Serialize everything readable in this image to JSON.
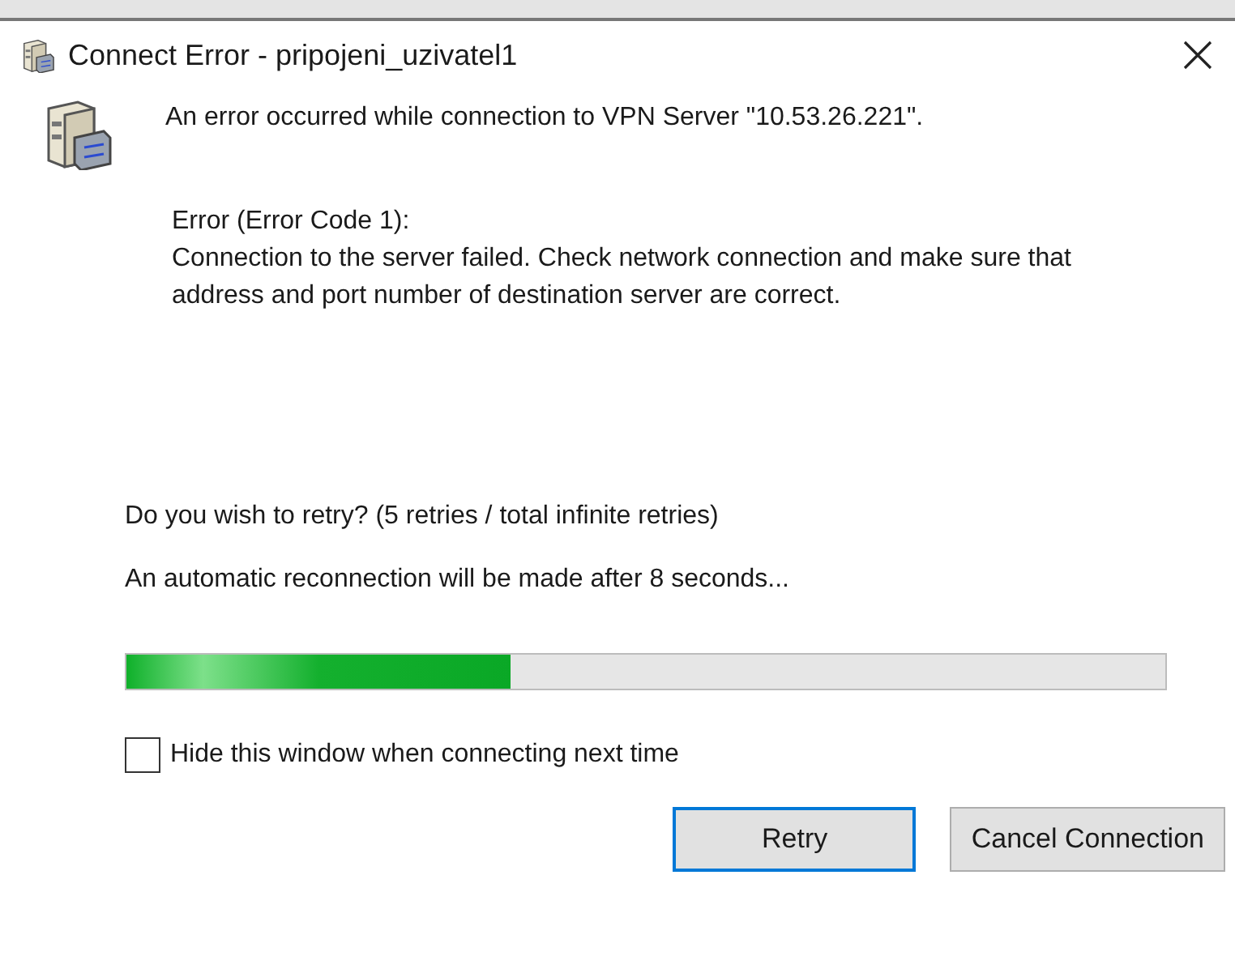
{
  "window": {
    "title": "Connect Error - pripojeni_uzivatel1"
  },
  "message": "An error occurred while connection to VPN Server \"10.53.26.221\".",
  "error_lines": [
    "Error (Error Code 1):",
    "Connection to the server failed. Check network connection and make sure that address and port number of destination server are correct."
  ],
  "retry_question": "Do you wish to retry? (5 retries / total infinite retries)",
  "reconnect_notice": "An automatic reconnection will be made after 8 seconds...",
  "progress": {
    "level": 0.37
  },
  "hide_checkbox": {
    "label": "Hide this window when connecting next time",
    "checked": false
  },
  "buttons": [
    {
      "label": "Retry",
      "selected": true
    },
    {
      "label": "Cancel Connection",
      "selected": false
    }
  ]
}
